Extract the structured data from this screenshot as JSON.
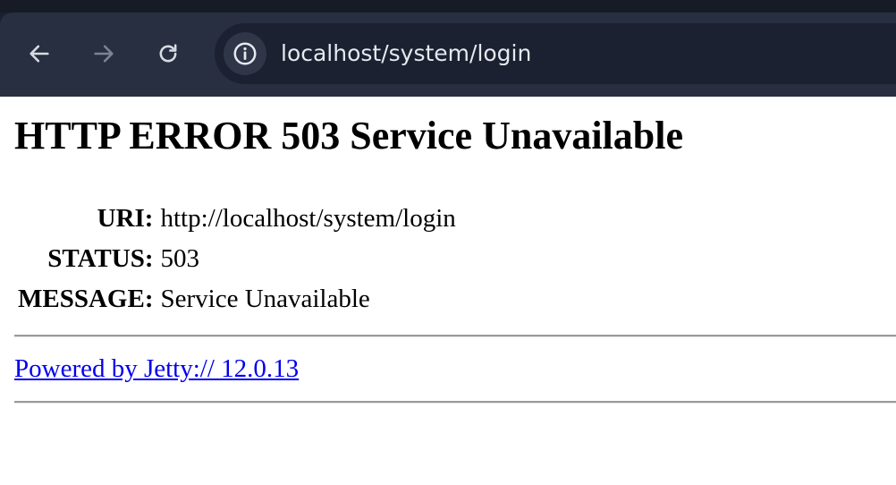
{
  "browser": {
    "url": "localhost/system/login",
    "icons": {
      "back": "arrow-left-icon",
      "forward": "arrow-right-icon",
      "reload": "reload-icon",
      "site_info": "info-icon"
    },
    "colors": {
      "chrome_background": "#272f40",
      "omnibox_background": "#1b2130",
      "url_text": "#e6e9ef"
    }
  },
  "page": {
    "title": "HTTP ERROR 503 Service Unavailable",
    "rows": [
      {
        "label": "URI:",
        "value": "http://localhost/system/login"
      },
      {
        "label": "STATUS:",
        "value": "503"
      },
      {
        "label": "MESSAGE:",
        "value": "Service Unavailable"
      }
    ],
    "footer_link": "Powered by Jetty:// 12.0.13",
    "colors": {
      "link": "#0000ee",
      "text": "#000000"
    }
  }
}
